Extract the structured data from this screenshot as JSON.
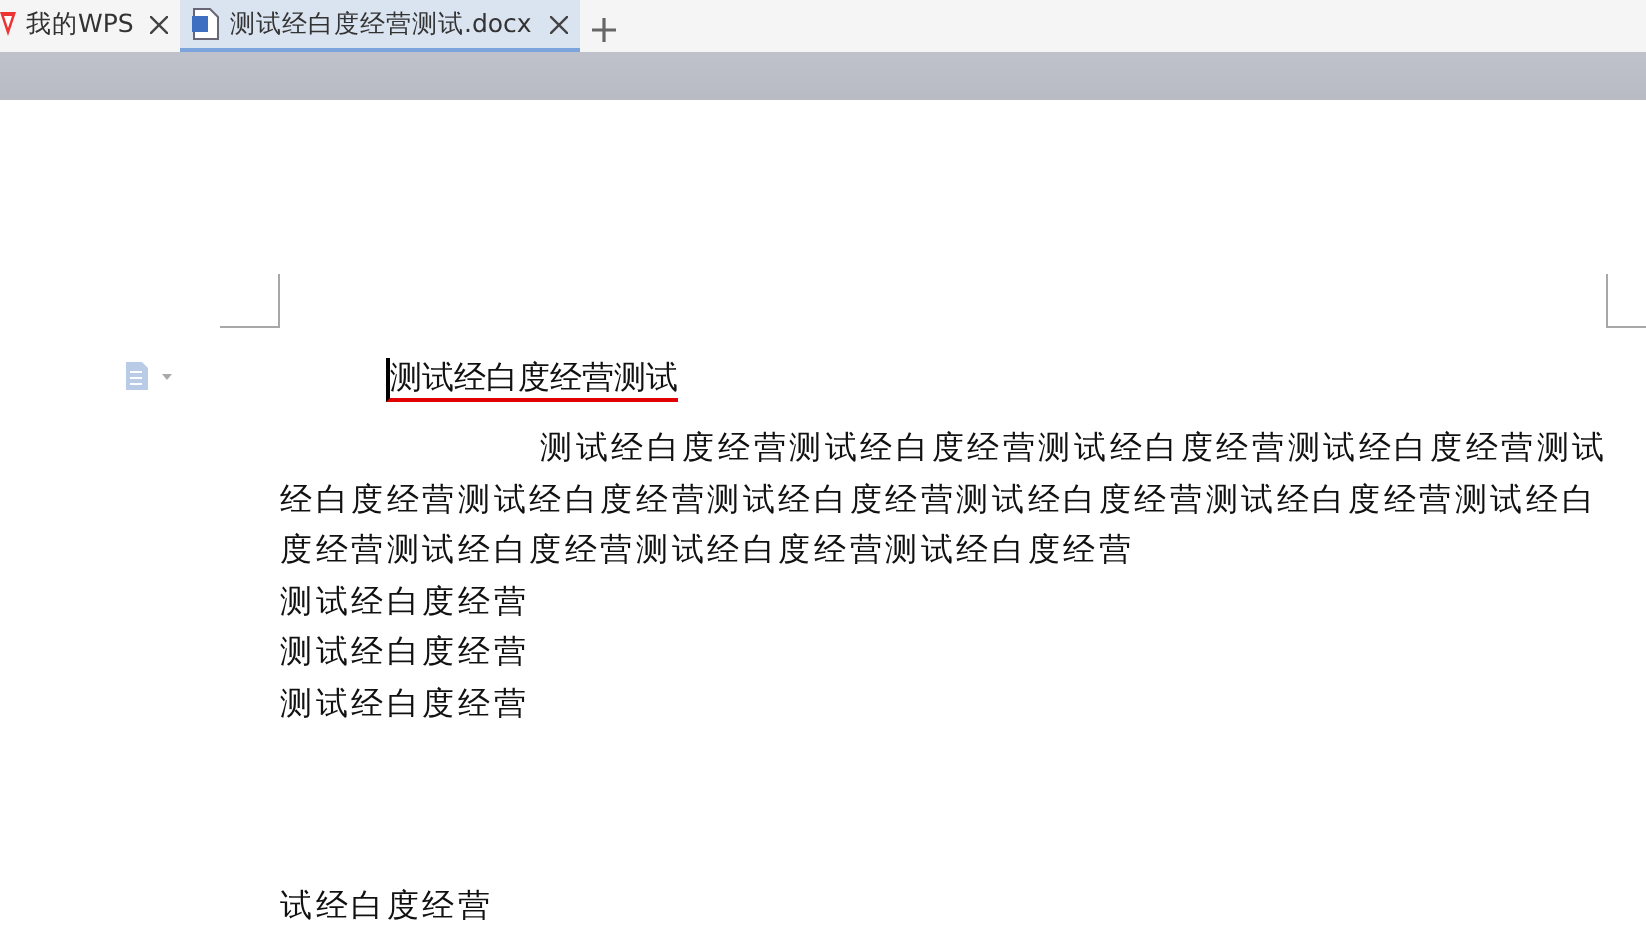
{
  "tabs": [
    {
      "label": "我的WPS",
      "selected": false,
      "kind": "home"
    },
    {
      "label": "测试经白度经营测试.docx",
      "selected": true,
      "kind": "doc"
    }
  ],
  "document": {
    "title": "测试经白度经营测试",
    "title_spellcheck": true,
    "paragraphs": [
      "测试经白度经营测试经白度经营测试经白度经营测试经白度经营测试经白度经营测试经白度经营测试经白度经营测试经白度经营测试经白度经营测试经白度经营测试经白度经营测试经白度经营测试经白度经营",
      "测试经白度经营",
      "测试经白度经营",
      "测试经白度经营"
    ],
    "trailing_line": "试经白度经营"
  }
}
